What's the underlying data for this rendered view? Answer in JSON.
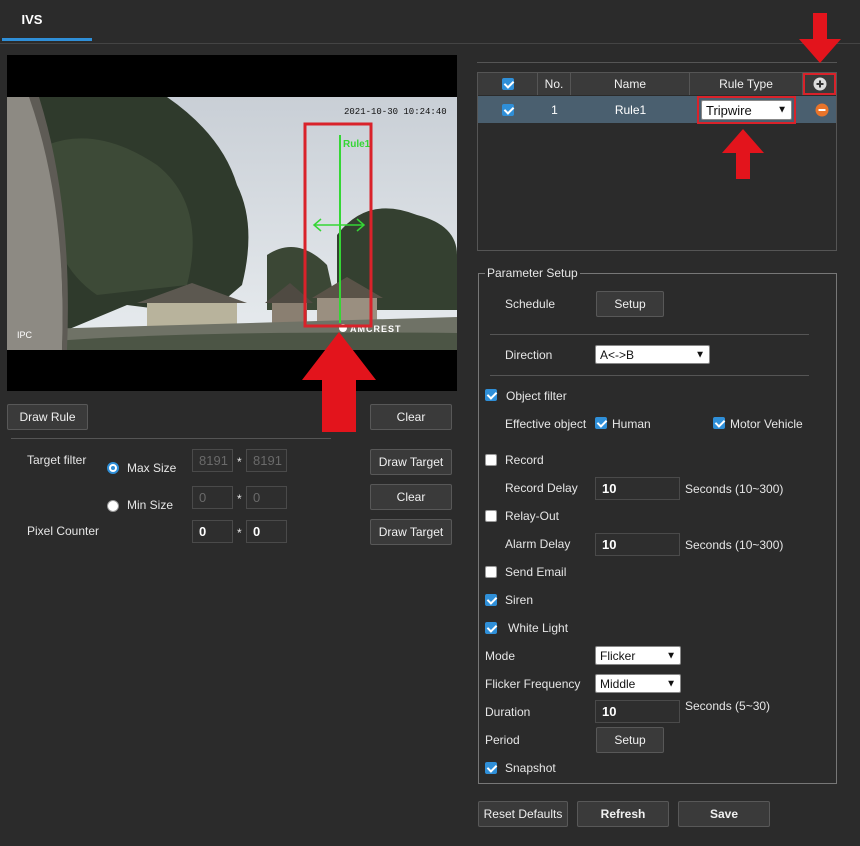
{
  "tabs": [
    {
      "label": "IVS"
    }
  ],
  "video": {
    "timestamp": "2021-10-30 10:24:40",
    "rule_label": "Rule1",
    "watermark": "AMCREST",
    "corner_label": "IPC"
  },
  "left_controls": {
    "draw_rule": "Draw Rule",
    "clear_top": "Clear",
    "target_filter_label": "Target filter",
    "max_size_label": "Max Size",
    "min_size_label": "Min Size",
    "max_w": "8191",
    "max_h": "8191",
    "min_w": "0",
    "min_h": "0",
    "times": "*",
    "draw_target_1": "Draw Target",
    "clear_2": "Clear",
    "draw_target_2": "Draw Target",
    "pixel_counter_label": "Pixel Counter",
    "pix_w": "0",
    "pix_h": "0"
  },
  "rules_table": {
    "headers": {
      "no": "No.",
      "name": "Name",
      "rule_type": "Rule Type"
    },
    "rows": [
      {
        "no": "1",
        "name": "Rule1",
        "rule_type": "Tripwire"
      }
    ]
  },
  "params": {
    "legend": "Parameter Setup",
    "schedule_label": "Schedule",
    "setup": "Setup",
    "direction_label": "Direction",
    "direction_value": "A<->B",
    "object_filter": "Object filter",
    "effective_object": "Effective object",
    "human": "Human",
    "motor_vehicle": "Motor Vehicle",
    "record": "Record",
    "record_delay": "Record Delay",
    "record_delay_value": "10",
    "record_delay_unit": "Seconds (10~300)",
    "relay_out": "Relay-Out",
    "alarm_delay": "Alarm Delay",
    "alarm_delay_value": "10",
    "alarm_delay_unit": "Seconds (10~300)",
    "send_email": "Send Email",
    "siren": "Siren",
    "white_light": "White Light",
    "mode": "Mode",
    "mode_value": "Flicker",
    "flicker_frequency": "Flicker Frequency",
    "flicker_value": "Middle",
    "duration": "Duration",
    "duration_value": "10",
    "duration_unit": "Seconds (5~30)",
    "period": "Period",
    "period_setup": "Setup",
    "snapshot": "Snapshot"
  },
  "footer": {
    "reset": "Reset Defaults",
    "refresh": "Refresh",
    "save": "Save"
  },
  "colors": {
    "accent": "#2f8fd8",
    "highlight": "#d9222a",
    "selected_row": "#4a5f6f"
  }
}
